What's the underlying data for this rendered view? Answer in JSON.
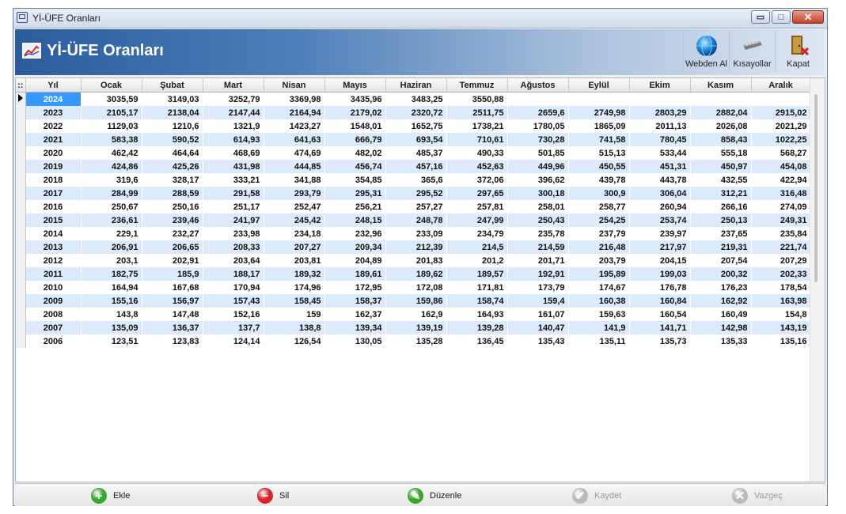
{
  "window": {
    "title": "Yİ-ÜFE Oranları",
    "controls": {
      "minimize": "▭",
      "maximize": "□",
      "close": "✕"
    }
  },
  "header": {
    "title": "Yİ-ÜFE Oranları",
    "icon": "chart-icon",
    "toolbar": [
      {
        "label": "Webden Al",
        "icon": "globe-icon"
      },
      {
        "label": "Kısayollar",
        "icon": "keyboard-icon"
      },
      {
        "label": "Kapat",
        "icon": "exit-door-icon"
      }
    ]
  },
  "grid": {
    "columns": [
      "Yıl",
      "Ocak",
      "Şubat",
      "Mart",
      "Nisan",
      "Mayıs",
      "Haziran",
      "Temmuz",
      "Ağustos",
      "Eylül",
      "Ekim",
      "Kasım",
      "Aralık"
    ],
    "rows": [
      [
        "2024",
        "3035,59",
        "3149,03",
        "3252,79",
        "3369,98",
        "3435,96",
        "3483,25",
        "3550,88",
        "",
        "",
        "",
        "",
        ""
      ],
      [
        "2023",
        "2105,17",
        "2138,04",
        "2147,44",
        "2164,94",
        "2179,02",
        "2320,72",
        "2511,75",
        "2659,6",
        "2749,98",
        "2803,29",
        "2882,04",
        "2915,02"
      ],
      [
        "2022",
        "1129,03",
        "1210,6",
        "1321,9",
        "1423,27",
        "1548,01",
        "1652,75",
        "1738,21",
        "1780,05",
        "1865,09",
        "2011,13",
        "2026,08",
        "2021,29"
      ],
      [
        "2021",
        "583,38",
        "590,52",
        "614,93",
        "641,63",
        "666,79",
        "693,54",
        "710,61",
        "730,28",
        "741,58",
        "780,45",
        "858,43",
        "1022,25"
      ],
      [
        "2020",
        "462,42",
        "464,64",
        "468,69",
        "474,69",
        "482,02",
        "485,37",
        "490,33",
        "501,85",
        "515,13",
        "533,44",
        "555,18",
        "568,27"
      ],
      [
        "2019",
        "424,86",
        "425,26",
        "431,98",
        "444,85",
        "456,74",
        "457,16",
        "452,63",
        "449,96",
        "450,55",
        "451,31",
        "450,97",
        "454,08"
      ],
      [
        "2018",
        "319,6",
        "328,17",
        "333,21",
        "341,88",
        "354,85",
        "365,6",
        "372,06",
        "396,62",
        "439,78",
        "443,78",
        "432,55",
        "422,94"
      ],
      [
        "2017",
        "284,99",
        "288,59",
        "291,58",
        "293,79",
        "295,31",
        "295,52",
        "297,65",
        "300,18",
        "300,9",
        "306,04",
        "312,21",
        "316,48"
      ],
      [
        "2016",
        "250,67",
        "250,16",
        "251,17",
        "252,47",
        "256,21",
        "257,27",
        "257,81",
        "258,01",
        "258,77",
        "260,94",
        "266,16",
        "274,09"
      ],
      [
        "2015",
        "236,61",
        "239,46",
        "241,97",
        "245,42",
        "248,15",
        "248,78",
        "247,99",
        "250,43",
        "254,25",
        "253,74",
        "250,13",
        "249,31"
      ],
      [
        "2014",
        "229,1",
        "232,27",
        "233,98",
        "234,18",
        "232,96",
        "233,09",
        "234,79",
        "235,78",
        "237,79",
        "239,97",
        "237,65",
        "235,84"
      ],
      [
        "2013",
        "206,91",
        "206,65",
        "208,33",
        "207,27",
        "209,34",
        "212,39",
        "214,5",
        "214,59",
        "216,48",
        "217,97",
        "219,31",
        "221,74"
      ],
      [
        "2012",
        "203,1",
        "202,91",
        "203,64",
        "203,81",
        "204,89",
        "201,83",
        "201,2",
        "201,71",
        "203,79",
        "204,15",
        "207,54",
        "207,29"
      ],
      [
        "2011",
        "182,75",
        "185,9",
        "188,17",
        "189,32",
        "189,61",
        "189,62",
        "189,57",
        "192,91",
        "195,89",
        "199,03",
        "200,32",
        "202,33"
      ],
      [
        "2010",
        "164,94",
        "167,68",
        "170,94",
        "174,96",
        "172,95",
        "172,08",
        "171,81",
        "173,79",
        "174,67",
        "176,78",
        "176,23",
        "178,54"
      ],
      [
        "2009",
        "155,16",
        "156,97",
        "157,43",
        "158,45",
        "158,37",
        "159,86",
        "158,74",
        "159,4",
        "160,38",
        "160,84",
        "162,92",
        "163,98"
      ],
      [
        "2008",
        "143,8",
        "147,48",
        "152,16",
        "159",
        "162,37",
        "162,9",
        "164,93",
        "161,07",
        "159,63",
        "160,54",
        "160,49",
        "154,8"
      ],
      [
        "2007",
        "135,09",
        "136,37",
        "137,7",
        "138,8",
        "139,34",
        "139,19",
        "139,28",
        "140,47",
        "141,9",
        "141,71",
        "142,98",
        "143,19"
      ],
      [
        "2006",
        "123,51",
        "123,83",
        "124,14",
        "126,54",
        "130,05",
        "135,28",
        "136,45",
        "135,43",
        "135,11",
        "135,73",
        "135,33",
        "135,16"
      ]
    ],
    "selected_row": 0,
    "indicator_header": "::"
  },
  "footer": {
    "buttons": [
      {
        "label": "Ekle",
        "icon": "add-icon",
        "color": "#3aa82f",
        "glyph": "+",
        "enabled": true
      },
      {
        "label": "Sil",
        "icon": "remove-icon",
        "color": "#d8262f",
        "glyph": "−",
        "enabled": true
      },
      {
        "label": "Düzenle",
        "icon": "edit-icon",
        "color": "#3aa82f",
        "glyph": "✎",
        "enabled": true
      },
      {
        "label": "Kaydet",
        "icon": "save-check-icon",
        "color": "#b9b9b9",
        "glyph": "✔",
        "enabled": false
      },
      {
        "label": "Vazgeç",
        "icon": "cancel-icon",
        "color": "#b9b9b9",
        "glyph": "✕",
        "enabled": false
      }
    ]
  }
}
